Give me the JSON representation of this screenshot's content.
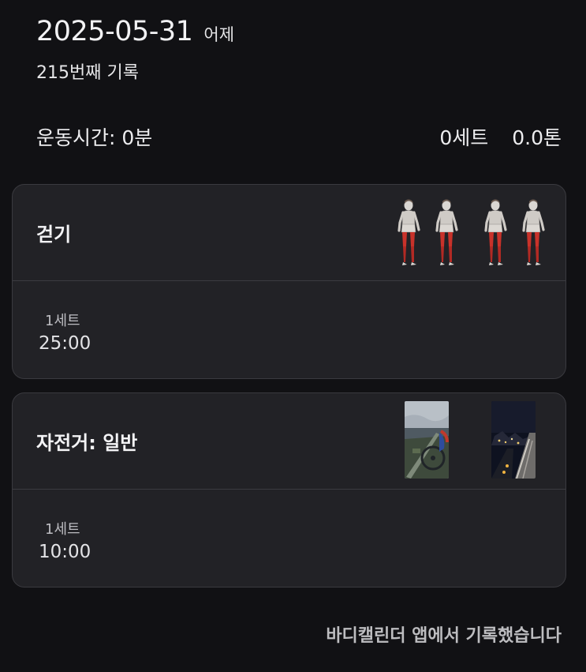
{
  "header": {
    "date": "2025-05-31",
    "relative_day": "어제",
    "record_count": "215번째 기록"
  },
  "summary": {
    "duration": "운동시간: 0분",
    "sets": "0세트",
    "volume": "0.0톤"
  },
  "exercises": [
    {
      "title": "걷기",
      "image": "walking-muscle-illustration",
      "sets": [
        {
          "label": "1세트",
          "value": "25:00"
        }
      ]
    },
    {
      "title": "자전거: 일반",
      "image": "cycling-photos",
      "sets": [
        {
          "label": "1세트",
          "value": "10:00"
        }
      ]
    }
  ],
  "footer": {
    "note": "바디캘린더 앱에서 기록했습니다"
  },
  "colors": {
    "background": "#111114",
    "card": "#222226",
    "muscle_highlight": "#C8322A"
  }
}
